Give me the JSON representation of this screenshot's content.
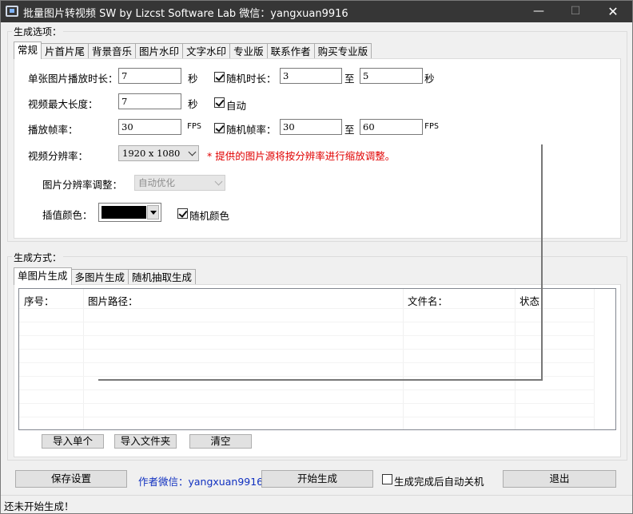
{
  "window": {
    "title": "批量图片转视频 SW  by Lizcst Software Lab  微信：yangxuan9916",
    "minimize": "—",
    "maximize": "☐",
    "close": "✕"
  },
  "options_group": {
    "label": "生成选项：",
    "tabs": [
      "常规",
      "片首片尾",
      "背景音乐",
      "图片水印",
      "文字水印",
      "专业版",
      "联系作者",
      "购买专业版"
    ],
    "active_tab": "常规"
  },
  "general": {
    "single_duration_label": "单张图片播放时长：",
    "single_duration_value": "7",
    "single_duration_unit": "秒",
    "random_duration_label": "随机时长：",
    "random_duration_checked": true,
    "random_min": "3",
    "random_to": "至",
    "random_max": "5",
    "random_unit": "秒",
    "max_length_label": "视频最大长度：",
    "max_length_value": "7",
    "max_length_unit": "秒",
    "auto_label": "自动",
    "auto_checked": true,
    "fps_label": "播放帧率：",
    "fps_value": "30",
    "fps_unit": "FPS",
    "random_fps_label": "随机帧率：",
    "random_fps_checked": true,
    "random_fps_min": "30",
    "random_fps_to": "至",
    "random_fps_max": "60",
    "random_fps_unit": "FPS",
    "resolution_label": "视频分辨率：",
    "resolution_value": "1920 x 1080",
    "resolution_note": "* 提供的图片源将按分辨率进行缩放调整。",
    "img_adjust_label": "图片分辨率调整：",
    "img_adjust_value": "自动优化",
    "fill_color_label": "插值颜色：",
    "fill_color": "#000000",
    "random_color_label": "随机颜色",
    "random_color_checked": true
  },
  "mode_group": {
    "label": "生成方式：",
    "tabs": [
      "单图片生成",
      "多图片生成",
      "随机抽取生成"
    ],
    "active_tab": "单图片生成",
    "columns": [
      "序号：",
      "图片路径：",
      "文件名：",
      "状态："
    ],
    "rows": []
  },
  "buttons": {
    "import_single": "导入单个",
    "import_folder": "导入文件夹",
    "clear": "清空",
    "save_settings": "保存设置",
    "author_wechat": "作者微信：yangxuan9916",
    "start": "开始生成",
    "auto_shutdown": "生成完成后自动关机",
    "auto_shutdown_checked": false,
    "exit": "退出"
  },
  "status": {
    "text": "还未开始生成！"
  }
}
